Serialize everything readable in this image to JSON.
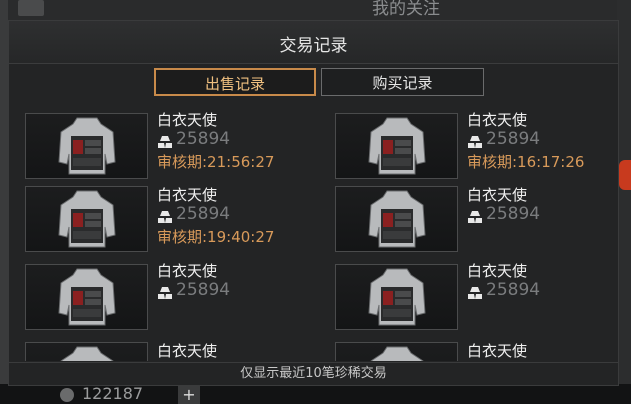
{
  "background": {
    "top_label": "我的关注",
    "currency_value": "122187",
    "plus_label": "+"
  },
  "dialog": {
    "title": "交易记录",
    "tabs": {
      "sale": "出售记录",
      "buy": "购买记录"
    },
    "footer": "仅显示最近10笔珍稀交易"
  },
  "records": [
    {
      "name": "白衣天使",
      "price": "25894",
      "review": "审核期:21:56:27"
    },
    {
      "name": "白衣天使",
      "price": "25894",
      "review": "审核期:16:17:26"
    },
    {
      "name": "白衣天使",
      "price": "25894",
      "review": "审核期:19:40:27"
    },
    {
      "name": "白衣天使",
      "price": "25894",
      "review": ""
    },
    {
      "name": "白衣天使",
      "price": "25894",
      "review": ""
    },
    {
      "name": "白衣天使",
      "price": "25894",
      "review": ""
    },
    {
      "name": "白衣天使",
      "price": "",
      "review": ""
    },
    {
      "name": "白衣天使",
      "price": "",
      "review": ""
    }
  ],
  "icons": {
    "item": "body-armor-vest-icon",
    "currency": "gold-bars-icon"
  },
  "colors": {
    "active_tab_border": "#c88a4a",
    "review_text": "#d89a5a",
    "price_text": "#7a7c7e"
  }
}
